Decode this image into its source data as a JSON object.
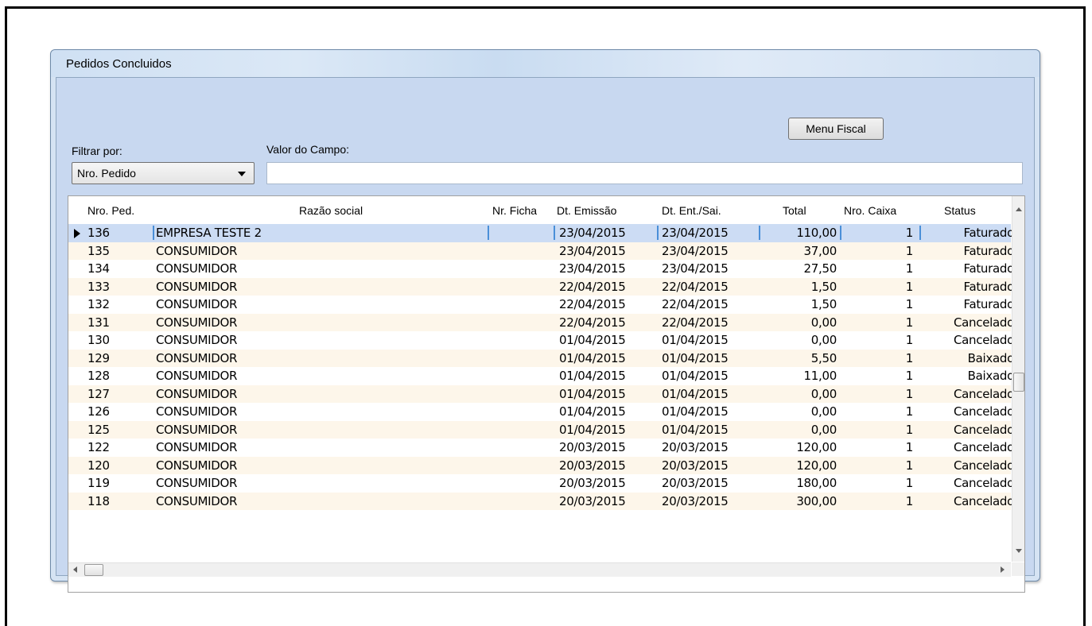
{
  "window": {
    "title": "Pedidos Concluidos"
  },
  "toolbar": {
    "menu_fiscal_label": "Menu Fiscal"
  },
  "filter": {
    "filter_label": "Filtrar por:",
    "filter_value": "Nro. Pedido",
    "field_label": "Valor do Campo:",
    "field_value": ""
  },
  "grid": {
    "columns": [
      "Nro. Ped.",
      "Razão social",
      "Nr. Ficha",
      "Dt. Emissão",
      "Dt. Ent./Sai.",
      "Total",
      "Nro. Caixa",
      "Status"
    ],
    "selected_row": 0,
    "rows": [
      [
        "136",
        "EMPRESA TESTE 2",
        "",
        "23/04/2015",
        "23/04/2015",
        "110,00",
        "1",
        "Faturado"
      ],
      [
        "135",
        "CONSUMIDOR",
        "",
        "23/04/2015",
        "23/04/2015",
        "37,00",
        "1",
        "Faturado"
      ],
      [
        "134",
        "CONSUMIDOR",
        "",
        "23/04/2015",
        "23/04/2015",
        "27,50",
        "1",
        "Faturado"
      ],
      [
        "133",
        "CONSUMIDOR",
        "",
        "22/04/2015",
        "22/04/2015",
        "1,50",
        "1",
        "Faturado"
      ],
      [
        "132",
        "CONSUMIDOR",
        "",
        "22/04/2015",
        "22/04/2015",
        "1,50",
        "1",
        "Faturado"
      ],
      [
        "131",
        "CONSUMIDOR",
        "",
        "22/04/2015",
        "22/04/2015",
        "0,00",
        "1",
        "Cancelado"
      ],
      [
        "130",
        "CONSUMIDOR",
        "",
        "01/04/2015",
        "01/04/2015",
        "0,00",
        "1",
        "Cancelado"
      ],
      [
        "129",
        "CONSUMIDOR",
        "",
        "01/04/2015",
        "01/04/2015",
        "5,50",
        "1",
        "Baixado"
      ],
      [
        "128",
        "CONSUMIDOR",
        "",
        "01/04/2015",
        "01/04/2015",
        "11,00",
        "1",
        "Baixado"
      ],
      [
        "127",
        "CONSUMIDOR",
        "",
        "01/04/2015",
        "01/04/2015",
        "0,00",
        "1",
        "Cancelado"
      ],
      [
        "126",
        "CONSUMIDOR",
        "",
        "01/04/2015",
        "01/04/2015",
        "0,00",
        "1",
        "Cancelado"
      ],
      [
        "125",
        "CONSUMIDOR",
        "",
        "01/04/2015",
        "01/04/2015",
        "0,00",
        "1",
        "Cancelado"
      ],
      [
        "122",
        "CONSUMIDOR",
        "",
        "20/03/2015",
        "20/03/2015",
        "120,00",
        "1",
        "Cancelado"
      ],
      [
        "120",
        "CONSUMIDOR",
        "",
        "20/03/2015",
        "20/03/2015",
        "120,00",
        "1",
        "Cancelado"
      ],
      [
        "119",
        "CONSUMIDOR",
        "",
        "20/03/2015",
        "20/03/2015",
        "180,00",
        "1",
        "Cancelado"
      ],
      [
        "118",
        "CONSUMIDOR",
        "",
        "20/03/2015",
        "20/03/2015",
        "300,00",
        "1",
        "Cancelado"
      ]
    ]
  },
  "colors": {
    "row_alt": "#fdf6ea",
    "row_selected": "#ccdcf4",
    "panel": "#c8d8f0"
  },
  "icons": {
    "row_indicator": "triangle-right-icon",
    "dropdown": "chevron-down-icon",
    "scroll_up": "arrow-up-icon",
    "scroll_down": "arrow-down-icon",
    "scroll_left": "arrow-left-icon",
    "scroll_right": "arrow-right-icon"
  }
}
